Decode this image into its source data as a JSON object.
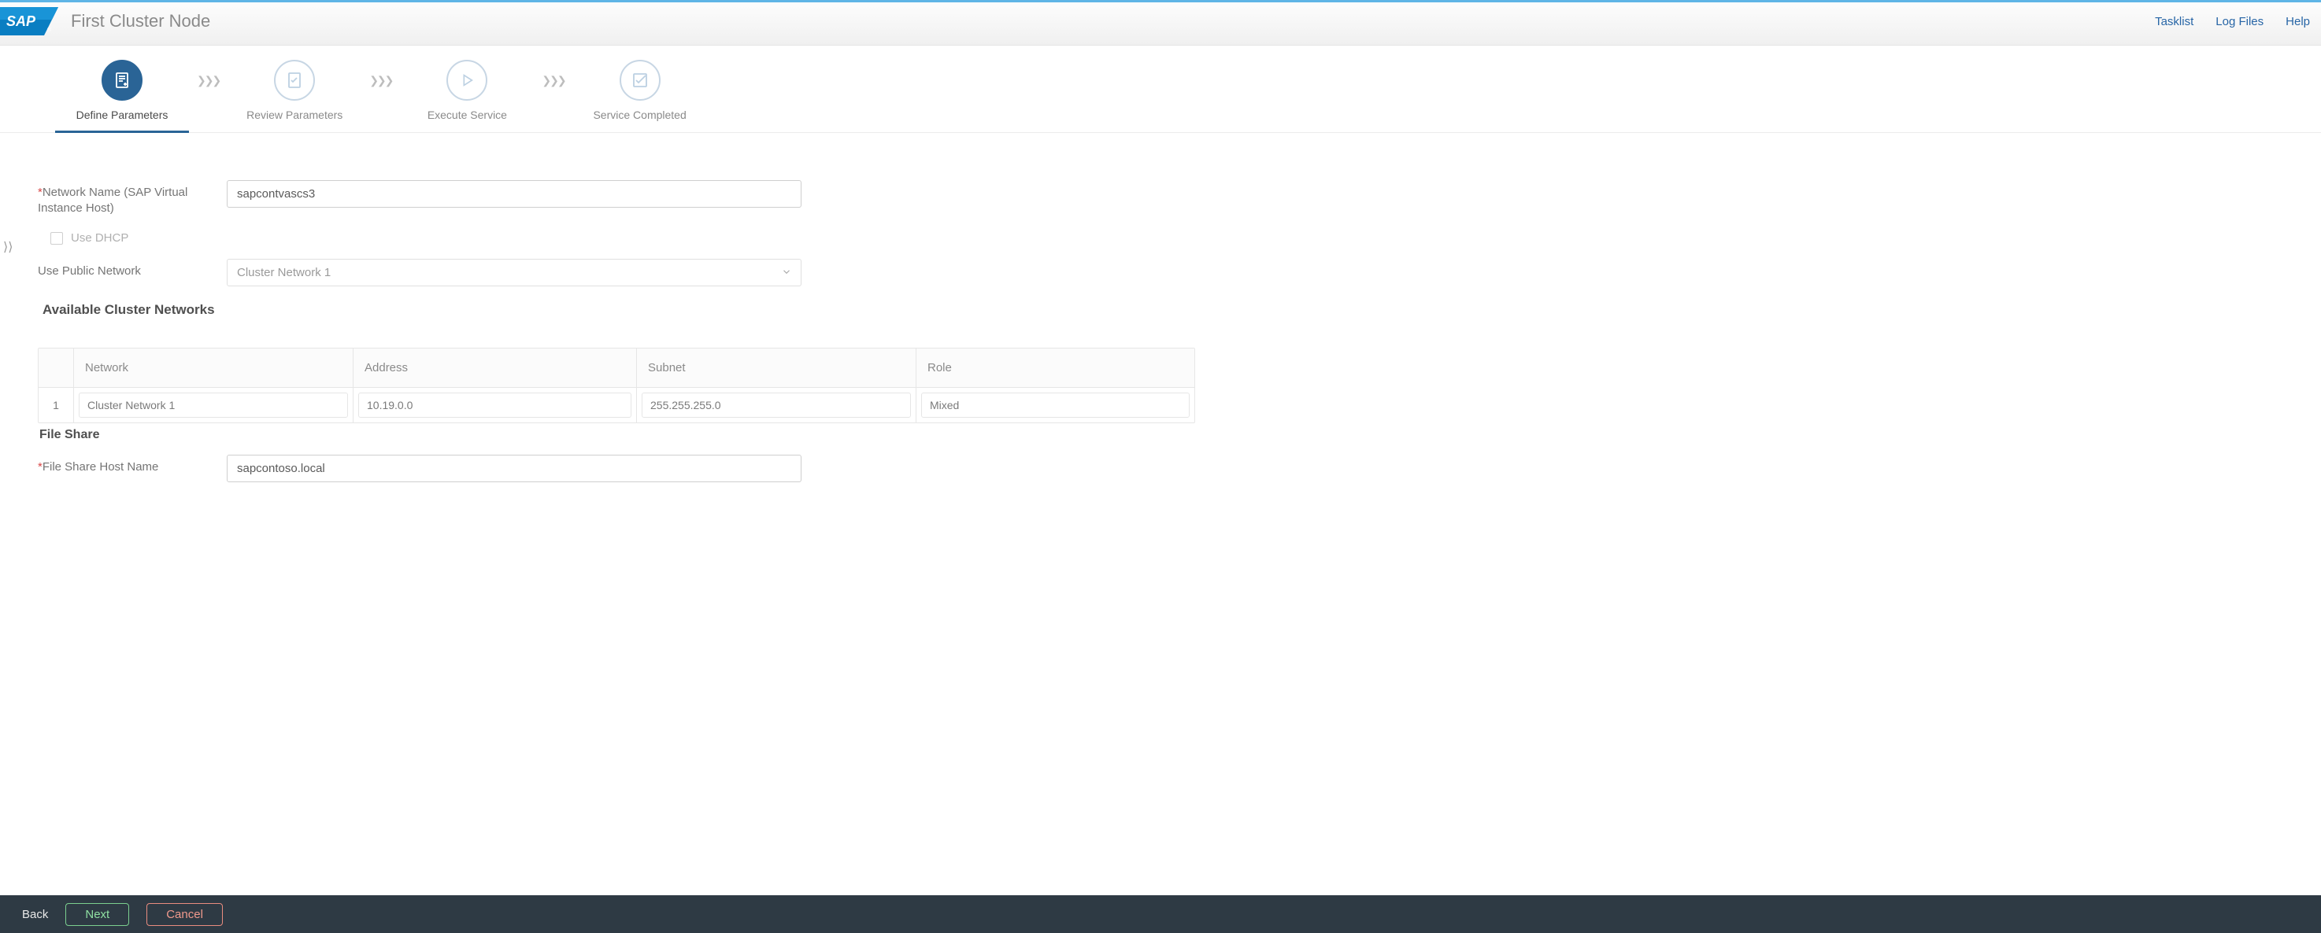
{
  "header": {
    "title": "First Cluster Node",
    "links": {
      "tasklist": "Tasklist",
      "logfiles": "Log Files",
      "help": "Help"
    }
  },
  "wizard": {
    "steps": [
      {
        "label": "Define Parameters"
      },
      {
        "label": "Review Parameters"
      },
      {
        "label": "Execute Service"
      },
      {
        "label": "Service Completed"
      }
    ]
  },
  "form": {
    "network_name_label": "Network Name (SAP Virtual Instance Host)",
    "network_name_value": "sapcontvascs3",
    "use_dhcp_label": "Use DHCP",
    "use_public_network_label": "Use Public Network",
    "use_public_network_value": "Cluster Network 1",
    "available_networks_title": "Available Cluster Networks",
    "file_share_title": "File Share",
    "file_share_host_label": "File Share Host Name",
    "file_share_host_value": "sapcontoso.local"
  },
  "table": {
    "headers": {
      "network": "Network",
      "address": "Address",
      "subnet": "Subnet",
      "role": "Role"
    },
    "rows": [
      {
        "idx": "1",
        "network": "Cluster Network 1",
        "address": "10.19.0.0",
        "subnet": "255.255.255.0",
        "role": "Mixed"
      }
    ]
  },
  "footer": {
    "back": "Back",
    "next": "Next",
    "cancel": "Cancel"
  }
}
